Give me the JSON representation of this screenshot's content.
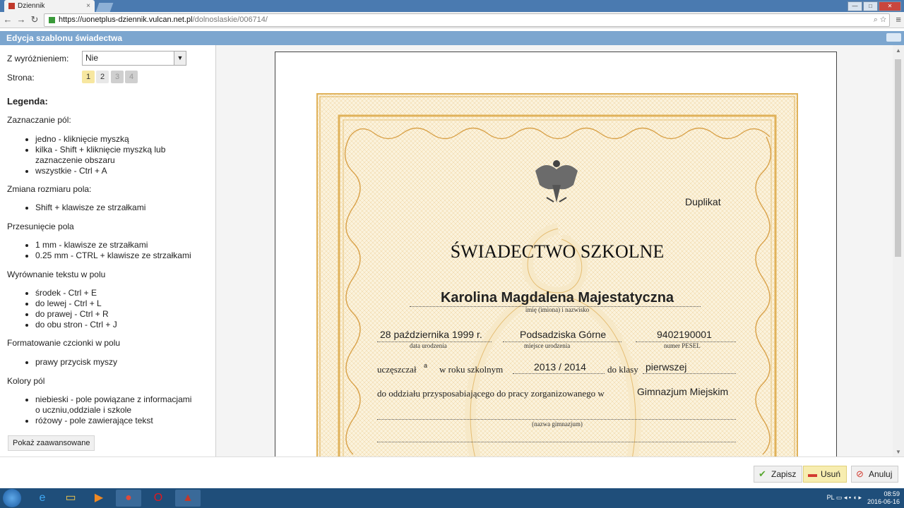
{
  "browser": {
    "tab_title": "Dziennik",
    "url_host": "https://uonetplus-dziennik.vulcan.net.pl",
    "url_path": "/dolnoslaskie/006714/"
  },
  "app": {
    "header_title": "Edycja szablonu świadectwa",
    "honors_label": "Z wyróżnieniem:",
    "honors_value": "Nie",
    "page_label": "Strona:",
    "pages": [
      "1",
      "2",
      "3",
      "4"
    ],
    "legend_title": "Legenda:",
    "sections": [
      {
        "title": "Zaznaczanie pól:",
        "items": [
          "jedno - kliknięcie myszką",
          "kilka - Shift + kliknięcie myszką lub zaznaczenie obszaru",
          "wszystkie - Ctrl + A"
        ]
      },
      {
        "title": "Zmiana rozmiaru pola:",
        "items": [
          "Shift + klawisze ze strzałkami"
        ]
      },
      {
        "title": "Przesunięcie pola",
        "items": [
          "1 mm - klawisze ze strzałkami",
          "0.25 mm - CTRL + klawisze ze strzałkami"
        ]
      },
      {
        "title": "Wyrównanie tekstu w polu",
        "items": [
          "środek - Ctrl + E",
          "do lewej - Ctrl + L",
          "do prawej - Ctrl + R",
          "do obu stron - Ctrl + J"
        ]
      },
      {
        "title": "Formatowanie czcionki w polu",
        "items": [
          "prawy przycisk myszy"
        ]
      },
      {
        "title": "Kolory pól",
        "items": [
          "niebieski - pole powiązane z informacjami o uczniu,oddziale i szkole",
          "różowy - pole zawierające tekst"
        ]
      }
    ],
    "advanced_button": "Pokaż zaawansowane"
  },
  "certificate": {
    "duplicate": "Duplikat",
    "title": "ŚWIADECTWO  SZKOLNE",
    "student_name": "Karolina Magdalena Majestatyczna",
    "name_caption": "imię (imiona) i nazwisko",
    "birth_date": "28 października 1999 r.",
    "birth_date_caption": "data urodzenia",
    "birth_place": "Podsadziska Górne",
    "birth_place_caption": "miejsce urodzenia",
    "pesel": "9402190001",
    "pesel_caption": "numer PESEL",
    "attended_text": "uczęszczał",
    "attended_suffix": "a",
    "school_year_text": "w roku szkolnym",
    "school_year": "2013 / 2014",
    "class_text": "do klasy",
    "class_value": "pierwszej",
    "division_text": "do oddziału przysposabiającego do pracy zorganizowanego w",
    "school_name": "Gimnazjum Miejskim",
    "school_caption": "(nazwa gimnazjum)"
  },
  "footer": {
    "save": "Zapisz",
    "delete": "Usuń",
    "cancel": "Anuluj"
  },
  "taskbar": {
    "lang": "PL",
    "time": "08:59",
    "date": "2016-06-16"
  },
  "colors": {
    "header": "#7ca6cf",
    "active_page": "#f7e7a0",
    "certificate_border": "#e0b25a",
    "certificate_bg": "#fbf2dc"
  }
}
